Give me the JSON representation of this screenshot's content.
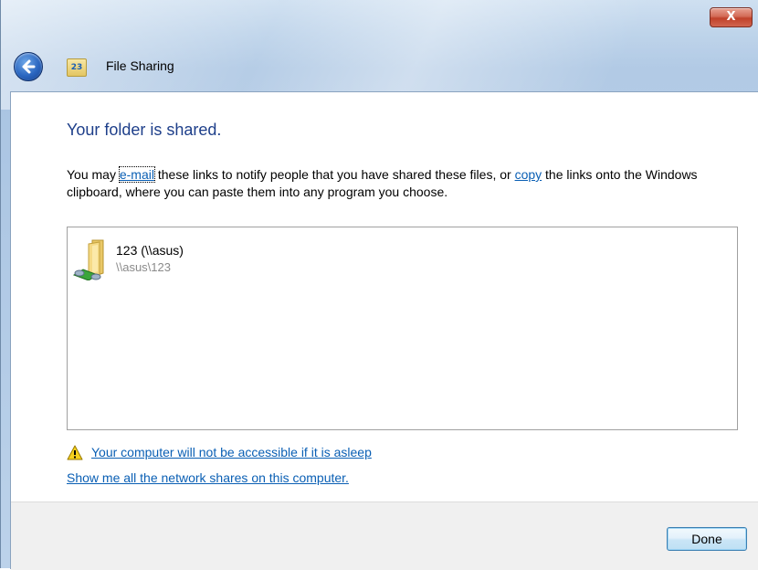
{
  "window": {
    "title": "File Sharing",
    "close_symbol": "X",
    "app_icon_text": "23"
  },
  "main": {
    "heading": "Your folder is shared.",
    "desc_part1": "You may ",
    "email_link": "e-mail",
    "desc_part2": " these links to notify people that you have shared these files, or ",
    "copy_link": "copy",
    "desc_part3": " the links onto the Windows clipboard, where you can paste them into any program you choose."
  },
  "shares": [
    {
      "name": "123 (\\\\asus)",
      "path": "\\\\asus\\123",
      "icon": "shared-folder-icon"
    }
  ],
  "links": {
    "sleep_warning": "Your computer will not be accessible if it is asleep",
    "show_shares": "Show me all the network shares on this computer."
  },
  "footer": {
    "done_label": "Done"
  },
  "colors": {
    "heading": "#1e3f8a",
    "link": "#0a5fb4",
    "path_text": "#8a8a8a"
  }
}
